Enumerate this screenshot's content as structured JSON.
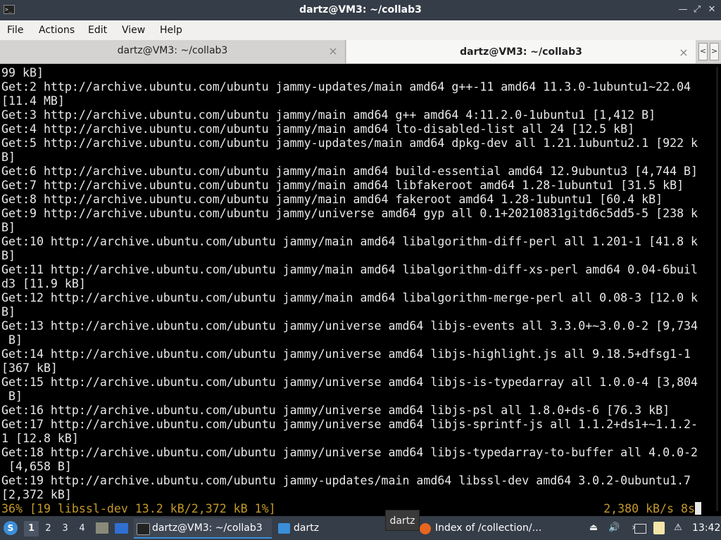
{
  "window": {
    "title": "dartz@VM3: ~/collab3"
  },
  "menu": [
    "File",
    "Actions",
    "Edit",
    "View",
    "Help"
  ],
  "tabs": [
    {
      "label": "dartz@VM3: ~/collab3",
      "active": false
    },
    {
      "label": "dartz@VM3: ~/collab3",
      "active": true
    }
  ],
  "terminal": {
    "lines": [
      "99 kB]",
      "Get:2 http://archive.ubuntu.com/ubuntu jammy-updates/main amd64 g++-11 amd64 11.3.0-1ubuntu1~22.04",
      "[11.4 MB]",
      "Get:3 http://archive.ubuntu.com/ubuntu jammy/main amd64 g++ amd64 4:11.2.0-1ubuntu1 [1,412 B]",
      "Get:4 http://archive.ubuntu.com/ubuntu jammy/main amd64 lto-disabled-list all 24 [12.5 kB]",
      "Get:5 http://archive.ubuntu.com/ubuntu jammy-updates/main amd64 dpkg-dev all 1.21.1ubuntu2.1 [922 k",
      "B]",
      "Get:6 http://archive.ubuntu.com/ubuntu jammy/main amd64 build-essential amd64 12.9ubuntu3 [4,744 B]",
      "Get:7 http://archive.ubuntu.com/ubuntu jammy/main amd64 libfakeroot amd64 1.28-1ubuntu1 [31.5 kB]",
      "Get:8 http://archive.ubuntu.com/ubuntu jammy/main amd64 fakeroot amd64 1.28-1ubuntu1 [60.4 kB]",
      "Get:9 http://archive.ubuntu.com/ubuntu jammy/universe amd64 gyp all 0.1+20210831gitd6c5dd5-5 [238 k",
      "B]",
      "Get:10 http://archive.ubuntu.com/ubuntu jammy/main amd64 libalgorithm-diff-perl all 1.201-1 [41.8 k",
      "B]",
      "Get:11 http://archive.ubuntu.com/ubuntu jammy/main amd64 libalgorithm-diff-xs-perl amd64 0.04-6buil",
      "d3 [11.9 kB]",
      "Get:12 http://archive.ubuntu.com/ubuntu jammy/main amd64 libalgorithm-merge-perl all 0.08-3 [12.0 k",
      "B]",
      "Get:13 http://archive.ubuntu.com/ubuntu jammy/universe amd64 libjs-events all 3.3.0+~3.0.0-2 [9,734",
      " B]",
      "Get:14 http://archive.ubuntu.com/ubuntu jammy/universe amd64 libjs-highlight.js all 9.18.5+dfsg1-1",
      "[367 kB]",
      "Get:15 http://archive.ubuntu.com/ubuntu jammy/universe amd64 libjs-is-typedarray all 1.0.0-4 [3,804",
      " B]",
      "Get:16 http://archive.ubuntu.com/ubuntu jammy/universe amd64 libjs-psl all 1.8.0+ds-6 [76.3 kB]",
      "Get:17 http://archive.ubuntu.com/ubuntu jammy/universe amd64 libjs-sprintf-js all 1.1.2+ds1+~1.1.2-",
      "1 [12.8 kB]",
      "Get:18 http://archive.ubuntu.com/ubuntu jammy/universe amd64 libjs-typedarray-to-buffer all 4.0.0-2",
      " [4,658 B]",
      "Get:19 http://archive.ubuntu.com/ubuntu jammy-updates/main amd64 libssl-dev amd64 3.0.2-0ubuntu1.7",
      "[2,372 kB]"
    ],
    "status_left": "36% [19 libssl-dev 13.2 kB/2,372 kB 1%]",
    "status_right": "2,380 kB/s 8s",
    "status_color": "#c49a2a"
  },
  "taskbar": {
    "workspaces": [
      "1",
      "2",
      "3",
      "4"
    ],
    "tasks": [
      {
        "label": "dartz@VM3: ~/collab3",
        "icon": "terminal-icon",
        "active": true
      },
      {
        "label": "dartz",
        "icon": "folder-icon",
        "active": false
      },
      {
        "label": "Index of /collection/…",
        "icon": "firefox-icon",
        "active": false
      }
    ],
    "tooltip": "dartz",
    "clock": "13:42"
  },
  "colors": {
    "titlebar": "#353d48",
    "accent": "#3b8ed8"
  }
}
